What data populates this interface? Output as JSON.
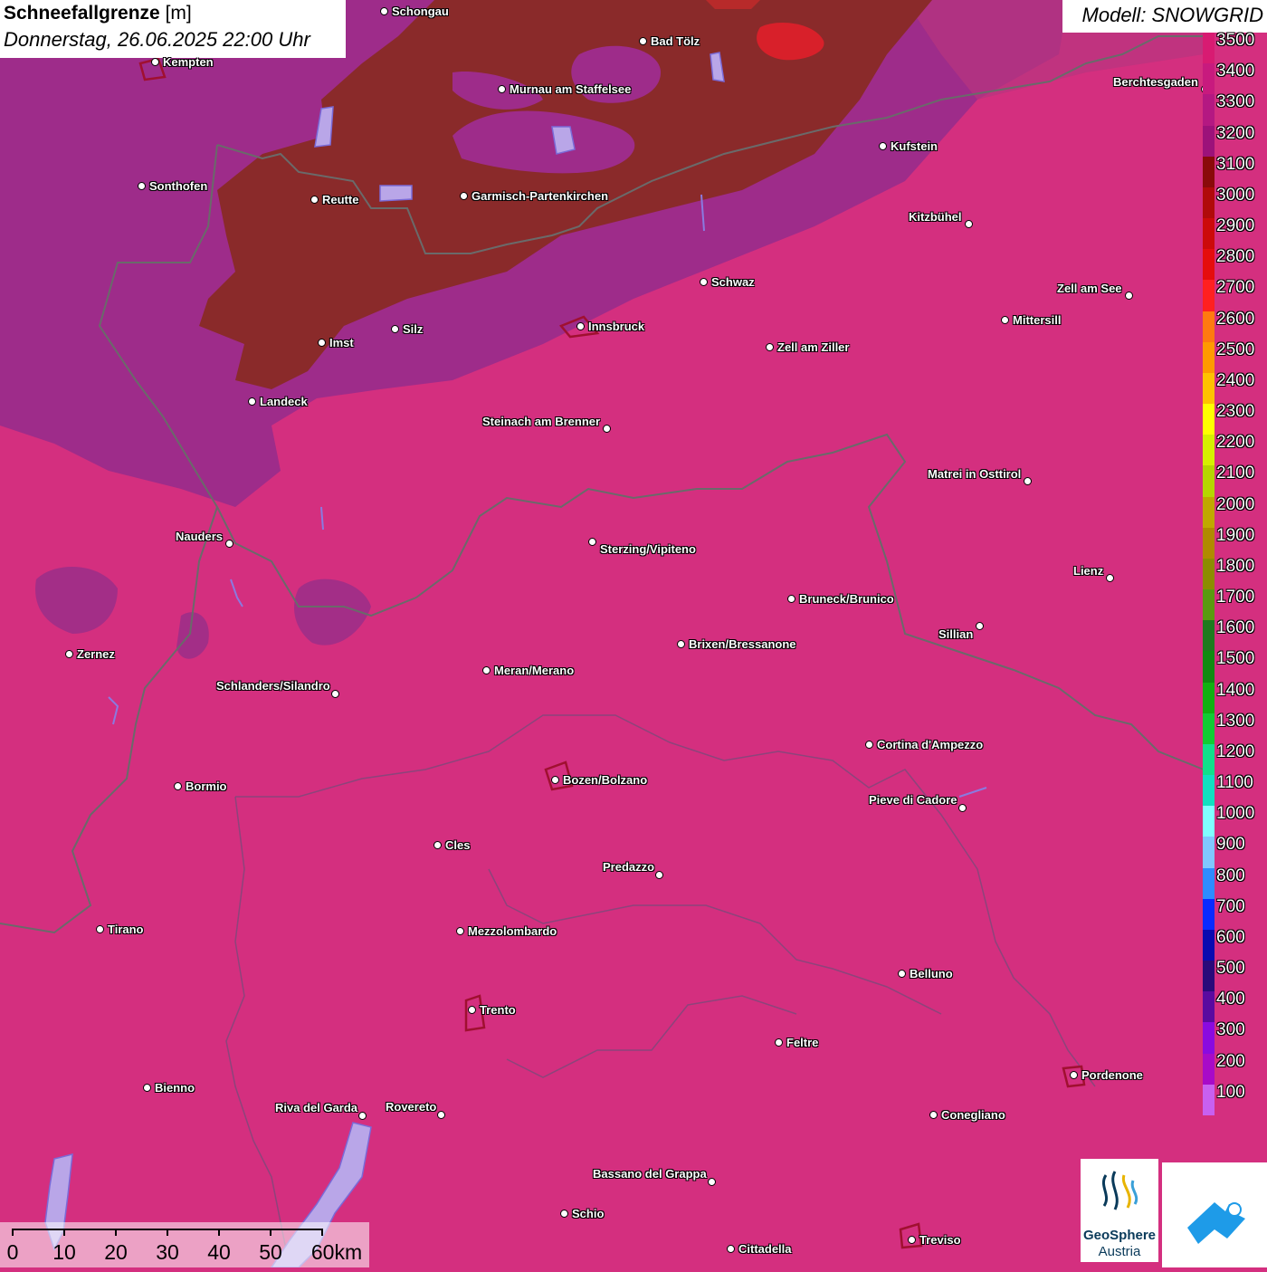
{
  "title": {
    "parameter": "Schneefallgrenze",
    "unit": "[m]",
    "date": "Donnerstag, 26.06.2025 22:00 Uhr"
  },
  "model": "Modell: SNOWGRID",
  "cities": [
    {
      "name": "Schongau"
    },
    {
      "name": "Bad Tölz"
    },
    {
      "name": "Kempten"
    },
    {
      "name": "Murnau am Staffelsee"
    },
    {
      "name": "Berchtesgaden"
    },
    {
      "name": "Kufstein"
    },
    {
      "name": "Sonthofen"
    },
    {
      "name": "Reutte"
    },
    {
      "name": "Garmisch-Partenkirchen"
    },
    {
      "name": "Kitzbühel"
    },
    {
      "name": "Schwaz"
    },
    {
      "name": "Zell am See"
    },
    {
      "name": "Mittersill"
    },
    {
      "name": "Silz"
    },
    {
      "name": "Innsbruck"
    },
    {
      "name": "Imst"
    },
    {
      "name": "Zell am Ziller"
    },
    {
      "name": "Landeck"
    },
    {
      "name": "Steinach am Brenner"
    },
    {
      "name": "Matrei in Osttirol"
    },
    {
      "name": "Nauders"
    },
    {
      "name": "Sterzing/Vipiteno"
    },
    {
      "name": "Lienz"
    },
    {
      "name": "Bruneck/Brunico"
    },
    {
      "name": "Sillian"
    },
    {
      "name": "Zernez"
    },
    {
      "name": "Brixen/Bressanone"
    },
    {
      "name": "Meran/Merano"
    },
    {
      "name": "Schlanders/Silandro"
    },
    {
      "name": "Cortina d'Ampezzo"
    },
    {
      "name": "Bozen/Bolzano"
    },
    {
      "name": "Bormio"
    },
    {
      "name": "Pieve di Cadore"
    },
    {
      "name": "Cles"
    },
    {
      "name": "Predazzo"
    },
    {
      "name": "Tirano"
    },
    {
      "name": "Mezzolombardo"
    },
    {
      "name": "Belluno"
    },
    {
      "name": "Trento"
    },
    {
      "name": "Feltre"
    },
    {
      "name": "Pordenone"
    },
    {
      "name": "Bienno"
    },
    {
      "name": "Riva del Garda"
    },
    {
      "name": "Rovereto"
    },
    {
      "name": "Conegliano"
    },
    {
      "name": "Bassano del Grappa"
    },
    {
      "name": "Schio"
    },
    {
      "name": "Treviso"
    },
    {
      "name": "Cittadella"
    }
  ],
  "legend": {
    "labels": [
      "3500",
      "3400",
      "3300",
      "3200",
      "3100",
      "3000",
      "2900",
      "2800",
      "2700",
      "2600",
      "2500",
      "2400",
      "2300",
      "2200",
      "2100",
      "2000",
      "1900",
      "1800",
      "1700",
      "1600",
      "1500",
      "1400",
      "1300",
      "1200",
      "1100",
      "1000",
      "900",
      "800",
      "700",
      "600",
      "500",
      "400",
      "300",
      "200",
      "100"
    ],
    "colors": [
      "#d81b72",
      "#c81a7e",
      "#b41882",
      "#9c127a",
      "#8a0a0a",
      "#b00a0a",
      "#cc0a0a",
      "#e50d0d",
      "#ff2020",
      "#ff7a10",
      "#ff9a00",
      "#ffc200",
      "#ffff00",
      "#d6f000",
      "#b6d600",
      "#c0a800",
      "#b08a00",
      "#8c8c00",
      "#5a9a10",
      "#1e7a1e",
      "#118a11",
      "#11b011",
      "#11cc33",
      "#11e08a",
      "#11e0c0",
      "#80ffff",
      "#80c8ff",
      "#2e8cff",
      "#0a2aff",
      "#0a0ab0",
      "#2a0a7a",
      "#5a0aa0",
      "#8a0ae0",
      "#a80ac8",
      "#c860f0"
    ]
  },
  "scale_bar": {
    "labels": [
      "0",
      "10",
      "20",
      "30",
      "40",
      "50",
      "60km"
    ]
  },
  "logo": {
    "line1": "GeoSphere",
    "line2": "Austria"
  },
  "colors": {
    "background": "#d42f7f",
    "warm_region": "#8a2a2a",
    "purple_region": "#9e2c8a"
  }
}
